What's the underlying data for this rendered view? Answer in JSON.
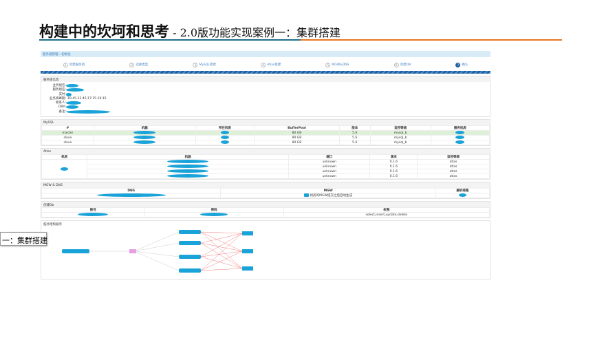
{
  "slide": {
    "title_main": "构建中的坎坷和思考",
    "title_sub": " - 2.0版功能实现案例一：集群搭建",
    "side_tag": "一：集群搭建"
  },
  "breadcrumb": [
    "服务组管理",
    "初始化"
  ],
  "steps": [
    {
      "n": "1",
      "label": "创建服务组"
    },
    {
      "n": "2",
      "label": "选择类型"
    },
    {
      "n": "3",
      "label": "MySQL搭建"
    },
    {
      "n": "4",
      "label": "Atlas搭建"
    },
    {
      "n": "5",
      "label": "MGW&DNS"
    },
    {
      "n": "6",
      "label": "创建DB"
    },
    {
      "n": "7",
      "label": "确认"
    }
  ],
  "info": {
    "title": "服务组信息",
    "labels": [
      "业务组名:",
      "服务组名:",
      "实时:",
      "业务高峰期:",
      "联系人:",
      "DBA:",
      "备注:"
    ],
    "peak": "10:45-12:45;17:15-19:15"
  },
  "mysql": {
    "title": "MySQL",
    "headers": [
      "#",
      "机器",
      "所在机房",
      "BufferPool",
      "版本",
      "监控等级",
      "服务机房"
    ],
    "rows": [
      {
        "role": "master",
        "bp": "80 GB",
        "ver": "5.6",
        "mon": "mysql_b"
      },
      {
        "role": "slave",
        "bp": "80 GB",
        "ver": "5.6",
        "mon": "mysql_b"
      },
      {
        "role": "slave",
        "bp": "80 GB",
        "ver": "5.6",
        "mon": "mysql_b"
      }
    ]
  },
  "atlas": {
    "title": "Atlas",
    "headers": [
      "机房",
      "机器",
      "端口",
      "版本",
      "监控等级"
    ],
    "rows": [
      {
        "port": "unknown",
        "ver": "0.1.6",
        "mon": "atlas"
      },
      {
        "port": "unknown",
        "ver": "0.1.6",
        "mon": "atlas"
      },
      {
        "port": "unknown",
        "ver": "0.1.6",
        "mon": "atlas"
      },
      {
        "port": "unknown",
        "ver": "0.1.6",
        "mon": "atlas"
      }
    ]
  },
  "mgw": {
    "title": "MGW & DNS",
    "headers": [
      "DNS",
      "MGW",
      "解析线路"
    ],
    "note": "机房的MGW提交之后自动生成"
  },
  "db": {
    "title": "创建Db",
    "headers": [
      "账号",
      "密码",
      "权限"
    ],
    "perm": "select,insert,update,delete"
  },
  "topo": {
    "title": "拓扑结构展示"
  },
  "colors": {
    "redact": "#1aa3d8",
    "accent": "#1f5f9f",
    "rule_left": "#1f6f8b",
    "rule_right": "#e87722"
  }
}
